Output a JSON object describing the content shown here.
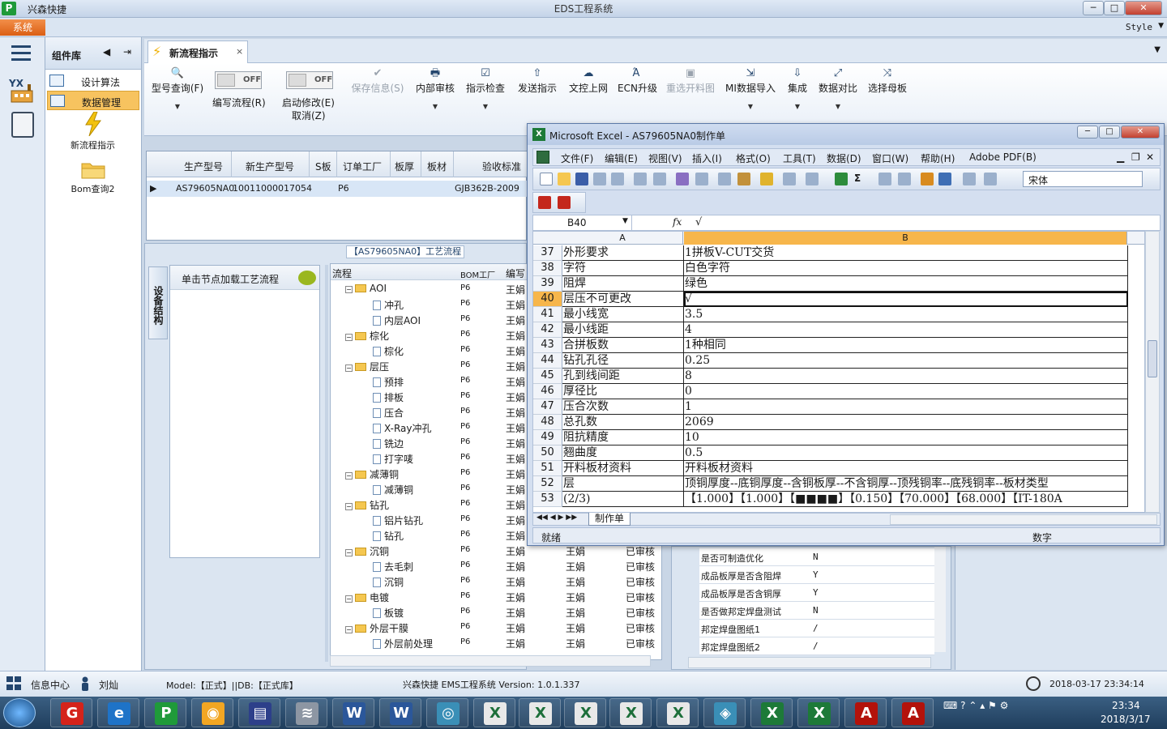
{
  "app": {
    "name": "兴森快捷",
    "window_title": "EDS工程系统",
    "menu_tab": "系统",
    "style_menu": "Style"
  },
  "library": {
    "title": "组件库",
    "items": [
      "设计算法",
      "数据管理"
    ],
    "big_items": [
      "新流程指示",
      "Bom查询2"
    ]
  },
  "doc_tab": {
    "label": "新流程指示",
    "close": "×"
  },
  "ribbon": {
    "model_query": "型号查询(F)",
    "toggle1_state": "OFF",
    "toggle1_label": "编写流程(R)",
    "toggle2_state": "OFF",
    "toggle2_label1": "启动修改(E)",
    "toggle2_label2": "取消(Z)",
    "save_info": "保存信息(S)",
    "internal_review": "内部审核",
    "instruction_check": "指示检查",
    "send_instruction": "发送指示",
    "upload_doc": "文控上网",
    "ecn_upgrade": "ECN升级",
    "reselect_material": "重选开料图",
    "mi_import": "MI数据导入",
    "integrate": "集成",
    "data_compare": "数据对比",
    "select_master": "选择母板"
  },
  "grid": {
    "headers": [
      "生产型号",
      "新生产型号",
      "S板",
      "订单工厂",
      "板厚",
      "板材",
      "验收标准"
    ],
    "row": {
      "model": "AS79605NA0",
      "new_model": "10011000017054",
      "factory": "P6",
      "standard": "GJB362B-2009"
    }
  },
  "flow": {
    "title": "【AS79605NA0】工艺流程",
    "equip_tab": "设备结构",
    "equip_label": "单击节点加载工艺流程",
    "tree_headers": [
      "流程",
      "BOM工厂",
      "编写"
    ],
    "rows": [
      {
        "name": "AOI",
        "type": "folder",
        "factory": "P6",
        "user": "王娟",
        "user2": "",
        "status": ""
      },
      {
        "name": "冲孔",
        "type": "doc",
        "factory": "P6",
        "user": "王娟",
        "user2": "",
        "status": ""
      },
      {
        "name": "内层AOI",
        "type": "doc",
        "factory": "P6",
        "user": "王娟",
        "user2": "",
        "status": ""
      },
      {
        "name": "棕化",
        "type": "folder",
        "factory": "P6",
        "user": "王娟",
        "user2": "",
        "status": ""
      },
      {
        "name": "棕化",
        "type": "doc",
        "factory": "P6",
        "user": "王娟",
        "user2": "",
        "status": ""
      },
      {
        "name": "层压",
        "type": "folder",
        "factory": "P6",
        "user": "王娟",
        "user2": "",
        "status": ""
      },
      {
        "name": "预排",
        "type": "doc",
        "factory": "P6",
        "user": "王娟",
        "user2": "",
        "status": ""
      },
      {
        "name": "排板",
        "type": "doc",
        "factory": "P6",
        "user": "王娟",
        "user2": "",
        "status": ""
      },
      {
        "name": "压合",
        "type": "doc",
        "factory": "P6",
        "user": "王娟",
        "user2": "",
        "status": ""
      },
      {
        "name": "X-Ray冲孔",
        "type": "doc",
        "factory": "P6",
        "user": "王娟",
        "user2": "",
        "status": ""
      },
      {
        "name": "铣边",
        "type": "doc",
        "factory": "P6",
        "user": "王娟",
        "user2": "",
        "status": ""
      },
      {
        "name": "打字唛",
        "type": "doc",
        "factory": "P6",
        "user": "王娟",
        "user2": "",
        "status": ""
      },
      {
        "name": "减薄铜",
        "type": "folder",
        "factory": "P6",
        "user": "王娟",
        "user2": "",
        "status": ""
      },
      {
        "name": "减薄铜",
        "type": "doc",
        "factory": "P6",
        "user": "王娟",
        "user2": "",
        "status": ""
      },
      {
        "name": "钻孔",
        "type": "folder",
        "factory": "P6",
        "user": "王娟",
        "user2": "",
        "status": ""
      },
      {
        "name": "铝片钻孔",
        "type": "doc",
        "factory": "P6",
        "user": "王娟",
        "user2": "",
        "status": ""
      },
      {
        "name": "钻孔",
        "type": "doc",
        "factory": "P6",
        "user": "王娟",
        "user2": "",
        "status": ""
      },
      {
        "name": "沉铜",
        "type": "folder",
        "factory": "P6",
        "user": "王娟",
        "user2": "王娟",
        "status": "已审核"
      },
      {
        "name": "去毛刺",
        "type": "doc",
        "factory": "P6",
        "user": "王娟",
        "user2": "王娟",
        "status": "已审核"
      },
      {
        "name": "沉铜",
        "type": "doc",
        "factory": "P6",
        "user": "王娟",
        "user2": "王娟",
        "status": "已审核"
      },
      {
        "name": "电镀",
        "type": "folder",
        "factory": "P6",
        "user": "王娟",
        "user2": "王娟",
        "status": "已审核"
      },
      {
        "name": "板镀",
        "type": "doc",
        "factory": "P6",
        "user": "王娟",
        "user2": "王娟",
        "status": "已审核"
      },
      {
        "name": "外层干膜",
        "type": "folder",
        "factory": "P6",
        "user": "王娟",
        "user2": "王娟",
        "status": "已审核"
      },
      {
        "name": "外层前处理",
        "type": "doc",
        "factory": "P6",
        "user": "王娟",
        "user2": "王娟",
        "status": "已审核"
      }
    ]
  },
  "props": [
    {
      "key": "是否可制造优化",
      "value": "N"
    },
    {
      "key": "成品板厚是否含阻焊",
      "value": "Y"
    },
    {
      "key": "成品板厚是否含铜厚",
      "value": "Y"
    },
    {
      "key": "是否做邦定焊盘测试",
      "value": "N"
    },
    {
      "key": "邦定焊盘图纸1",
      "value": "/"
    },
    {
      "key": "邦定焊盘图纸2",
      "value": "/"
    }
  ],
  "status": {
    "info_center": "信息中心",
    "user": "刘灿",
    "model": "Model:【正式】||DB:【正式库】",
    "version": "兴森快捷 EMS工程系统 Version: 1.0.1.337",
    "datetime": "2018-03-17 23:34:14"
  },
  "taskbar": {
    "time": "23:34",
    "date": "2018/3/17"
  },
  "excel": {
    "title": "Microsoft Excel - AS79605NA0制作单",
    "menu": [
      "文件(F)",
      "编辑(E)",
      "视图(V)",
      "插入(I)",
      "格式(O)",
      "工具(T)",
      "数据(D)",
      "窗口(W)",
      "帮助(H)",
      "Adobe PDF(B)"
    ],
    "font": "宋体",
    "namebox": "B40",
    "fx": "fx",
    "formula": "√",
    "col_a": "A",
    "col_b": "B",
    "rows": [
      {
        "n": "37",
        "a": "外形要求",
        "b": "1拼板V-CUT交货"
      },
      {
        "n": "38",
        "a": "字符",
        "b": "白色字符"
      },
      {
        "n": "39",
        "a": "阻焊",
        "b": "绿色"
      },
      {
        "n": "40",
        "a": "层压不可更改",
        "b": "√"
      },
      {
        "n": "41",
        "a": "最小线宽",
        "b": "3.5"
      },
      {
        "n": "42",
        "a": "最小线距",
        "b": "4"
      },
      {
        "n": "43",
        "a": "合拼板数",
        "b": "1种相同"
      },
      {
        "n": "44",
        "a": "钻孔孔径",
        "b": "0.25"
      },
      {
        "n": "45",
        "a": "孔到线间距",
        "b": "8"
      },
      {
        "n": "46",
        "a": "厚径比",
        "b": "0"
      },
      {
        "n": "47",
        "a": "压合次数",
        "b": "1"
      },
      {
        "n": "48",
        "a": "总孔数",
        "b": "2069"
      },
      {
        "n": "49",
        "a": "阻抗精度",
        "b": "10"
      },
      {
        "n": "50",
        "a": "翘曲度",
        "b": "0.5"
      },
      {
        "n": "51",
        "a": "开料板材资料",
        "b": "开料板材资料"
      },
      {
        "n": "52",
        "a": "层",
        "b": "顶铜厚度--底铜厚度--含铜板厚--不含铜厚--顶残铜率--底残铜率--板材类型"
      },
      {
        "n": "53",
        "a": "(2/3)",
        "b": "【1.000】【1.000】【■■■■】【0.150】【70.000】【68.000】【IT-180A"
      }
    ],
    "sheet_tab": "制作单",
    "status_ready": "就绪",
    "status_num": "数字"
  }
}
